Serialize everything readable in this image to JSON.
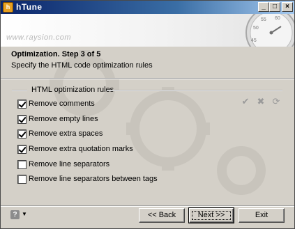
{
  "window": {
    "title": "hTune",
    "app_icon": "htune-app-icon",
    "controls": {
      "minimize": "_",
      "maximize": "□",
      "close": "×"
    }
  },
  "banner": {
    "brand_text": "www.raysion.com",
    "stopwatch_numbers": [
      "60",
      "55",
      "50",
      "45"
    ]
  },
  "wizard": {
    "step_title": "Optimization. Step 3 of 5",
    "step_description": "Specify the HTML code optimization rules"
  },
  "rules_group": {
    "label": "HTML optimization rules",
    "toolbar": [
      {
        "name": "check-all-icon",
        "glyph": "✔"
      },
      {
        "name": "uncheck-all-icon",
        "glyph": "✖"
      },
      {
        "name": "restore-defaults-icon",
        "glyph": "⟳"
      }
    ],
    "rules": [
      {
        "label": "Remove comments",
        "checked": true
      },
      {
        "label": "Remove empty lines",
        "checked": true
      },
      {
        "label": "Remove extra spaces",
        "checked": true
      },
      {
        "label": "Remove extra quotation marks",
        "checked": true
      },
      {
        "label": "Remove line separators",
        "checked": false
      },
      {
        "label": "Remove line separators between tags",
        "checked": false
      }
    ]
  },
  "footer": {
    "help_glyph": "?",
    "back_label": "<< Back",
    "next_label": "Next >>",
    "exit_label": "Exit"
  },
  "colors": {
    "dialog_face": "#d4d0c8",
    "titlebar_start": "#0a246a",
    "titlebar_end": "#a6caf0"
  }
}
